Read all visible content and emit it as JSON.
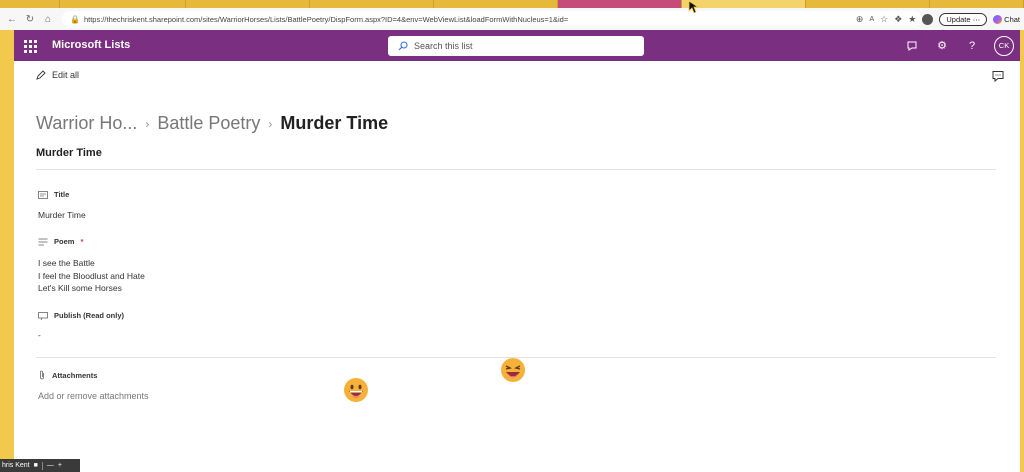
{
  "browser": {
    "url": "https://thechriskent.sharepoint.com/sites/WarriorHorses/Lists/BattlePoetry/DispForm.aspx?ID=4&env=WebViewList&loadFormWithNucleus=1&id=",
    "update_label": "Update",
    "chat_label": "Chat"
  },
  "suite": {
    "app_name": "Microsoft Lists",
    "search_placeholder": "Search this list",
    "avatar_initials": "CK"
  },
  "commandbar": {
    "edit_all_label": "Edit all"
  },
  "breadcrumb": {
    "site": "Warrior Ho...",
    "list": "Battle Poetry",
    "item": "Murder Time"
  },
  "item_title": "Murder Time",
  "fields": {
    "title": {
      "label": "Title",
      "value": "Murder Time"
    },
    "poem": {
      "label": "Poem",
      "required_mark": "*",
      "lines": [
        "I see the Battle",
        "I feel the Bloodlust and Hate",
        "Let's Kill some Horses"
      ]
    },
    "publish": {
      "label": "Publish (Read only)",
      "value": "-"
    },
    "attachments": {
      "label": "Attachments",
      "link": "Add or remove attachments"
    }
  },
  "meeting": {
    "name": "hris Kent"
  },
  "colors": {
    "suitebar": "#7b2f80",
    "browser_frame": "#f2c94c"
  }
}
